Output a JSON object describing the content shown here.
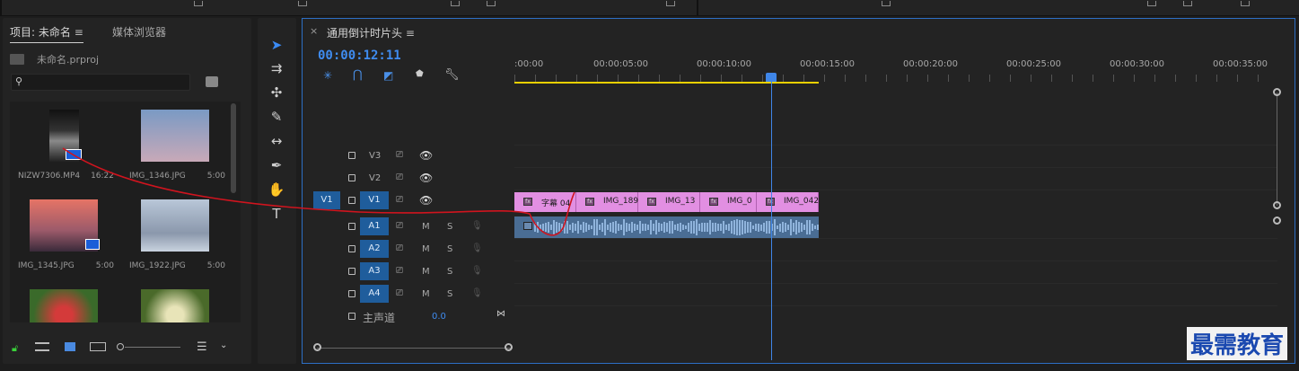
{
  "project_panel": {
    "tab_project": "项目: 未命名",
    "tab_media": "媒体浏览器",
    "project_file": "未命名.prproj",
    "items": [
      {
        "name": "NIZW7306.MP4",
        "duration": "16:22",
        "kind": "video"
      },
      {
        "name": "IMG_1346.JPG",
        "duration": "5:00",
        "kind": "sky"
      },
      {
        "name": "IMG_1345.JPG",
        "duration": "5:00",
        "kind": "sunset"
      },
      {
        "name": "IMG_1922.JPG",
        "duration": "5:00",
        "kind": "mountain"
      },
      {
        "name": "",
        "duration": "",
        "kind": "tulip-red"
      },
      {
        "name": "",
        "duration": "",
        "kind": "tulip-white"
      }
    ]
  },
  "timeline": {
    "title": "通用倒计时片头",
    "timecode": "00:00:12:11",
    "ruler": [
      ":00:00",
      "00:00:05:00",
      "00:00:10:00",
      "00:00:15:00",
      "00:00:20:00",
      "00:00:25:00",
      "00:00:30:00",
      "00:00:35:00"
    ],
    "video_tracks": [
      "V3",
      "V2",
      "V1"
    ],
    "audio_tracks": [
      "A1",
      "A2",
      "A3",
      "A4"
    ],
    "source_patch": "V1",
    "mute_label": "M",
    "solo_label": "S",
    "master_label": "主声道",
    "master_value": "0.0",
    "clips": [
      {
        "label": "字幕 04"
      },
      {
        "label": "IMG_189"
      },
      {
        "label": "IMG_13"
      },
      {
        "label": "IMG_0"
      },
      {
        "label": "IMG_042"
      }
    ]
  },
  "watermark": "最需教育",
  "colors": {
    "accent": "#3f8cf0",
    "clip": "#e28fe2",
    "audio": "#4a6d94",
    "work_area": "#e9d000",
    "annotation": "#d0141e"
  }
}
